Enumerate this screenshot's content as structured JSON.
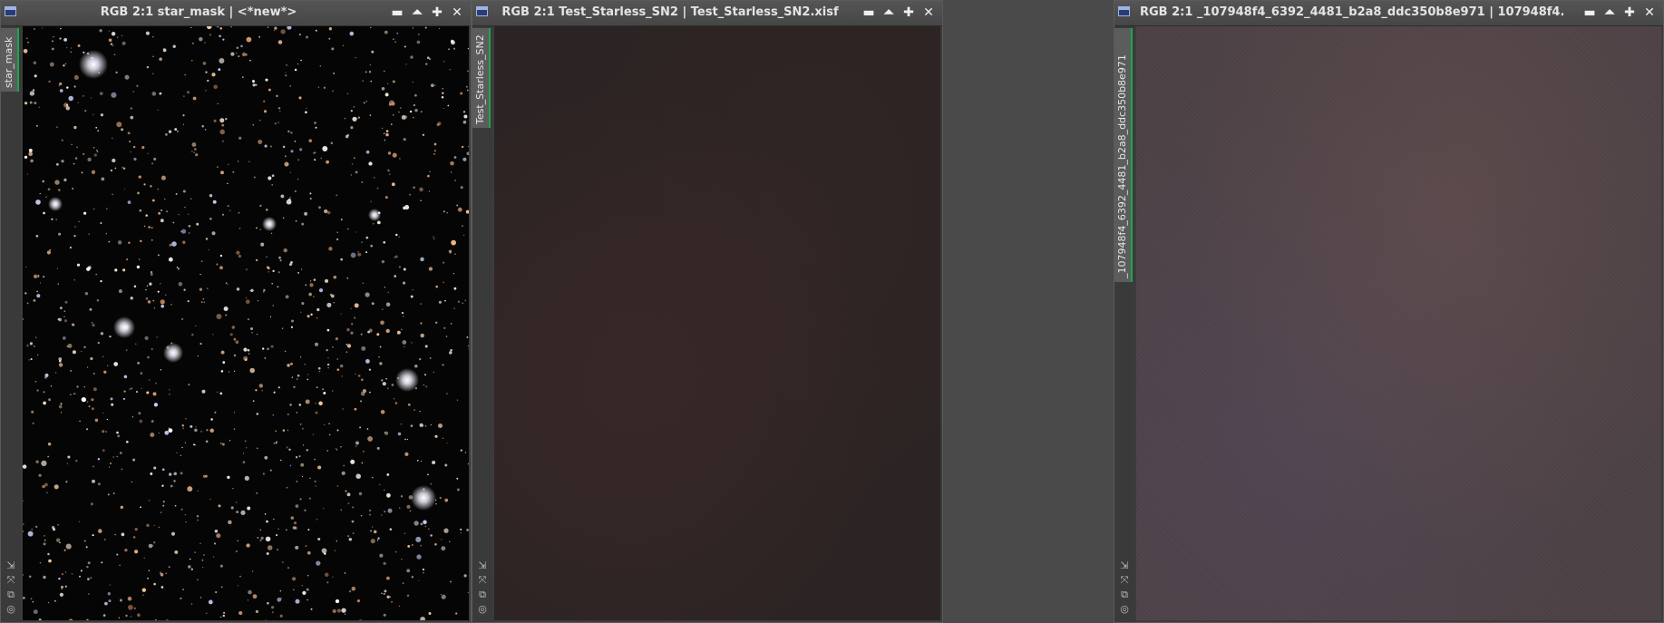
{
  "windows": [
    {
      "title": "RGB 2:1 star_mask | <*new*>",
      "tab_label": "star_mask"
    },
    {
      "title": "RGB 2:1 Test_Starless_SN2 | Test_Starless_SN2.xisf",
      "tab_label": "Test_Starless_SN2"
    },
    {
      "title": "RGB 2:1 _107948f4_6392_4481_b2a8_ddc350b8e971 | 107948f4...",
      "tab_label": "_107948f4_6392_4481_b2a8_ddc350b8e971"
    }
  ],
  "controls": {
    "minimize": "▬",
    "shade": "⏶",
    "maximize": "✚",
    "close": "✕"
  },
  "side_icons": {
    "fit": "⇲",
    "zoom": "⤧",
    "copy": "⧉",
    "target": "◎"
  },
  "colors": {
    "tab_accent": "#1aa84b",
    "sysicon": "#2a3c70"
  }
}
